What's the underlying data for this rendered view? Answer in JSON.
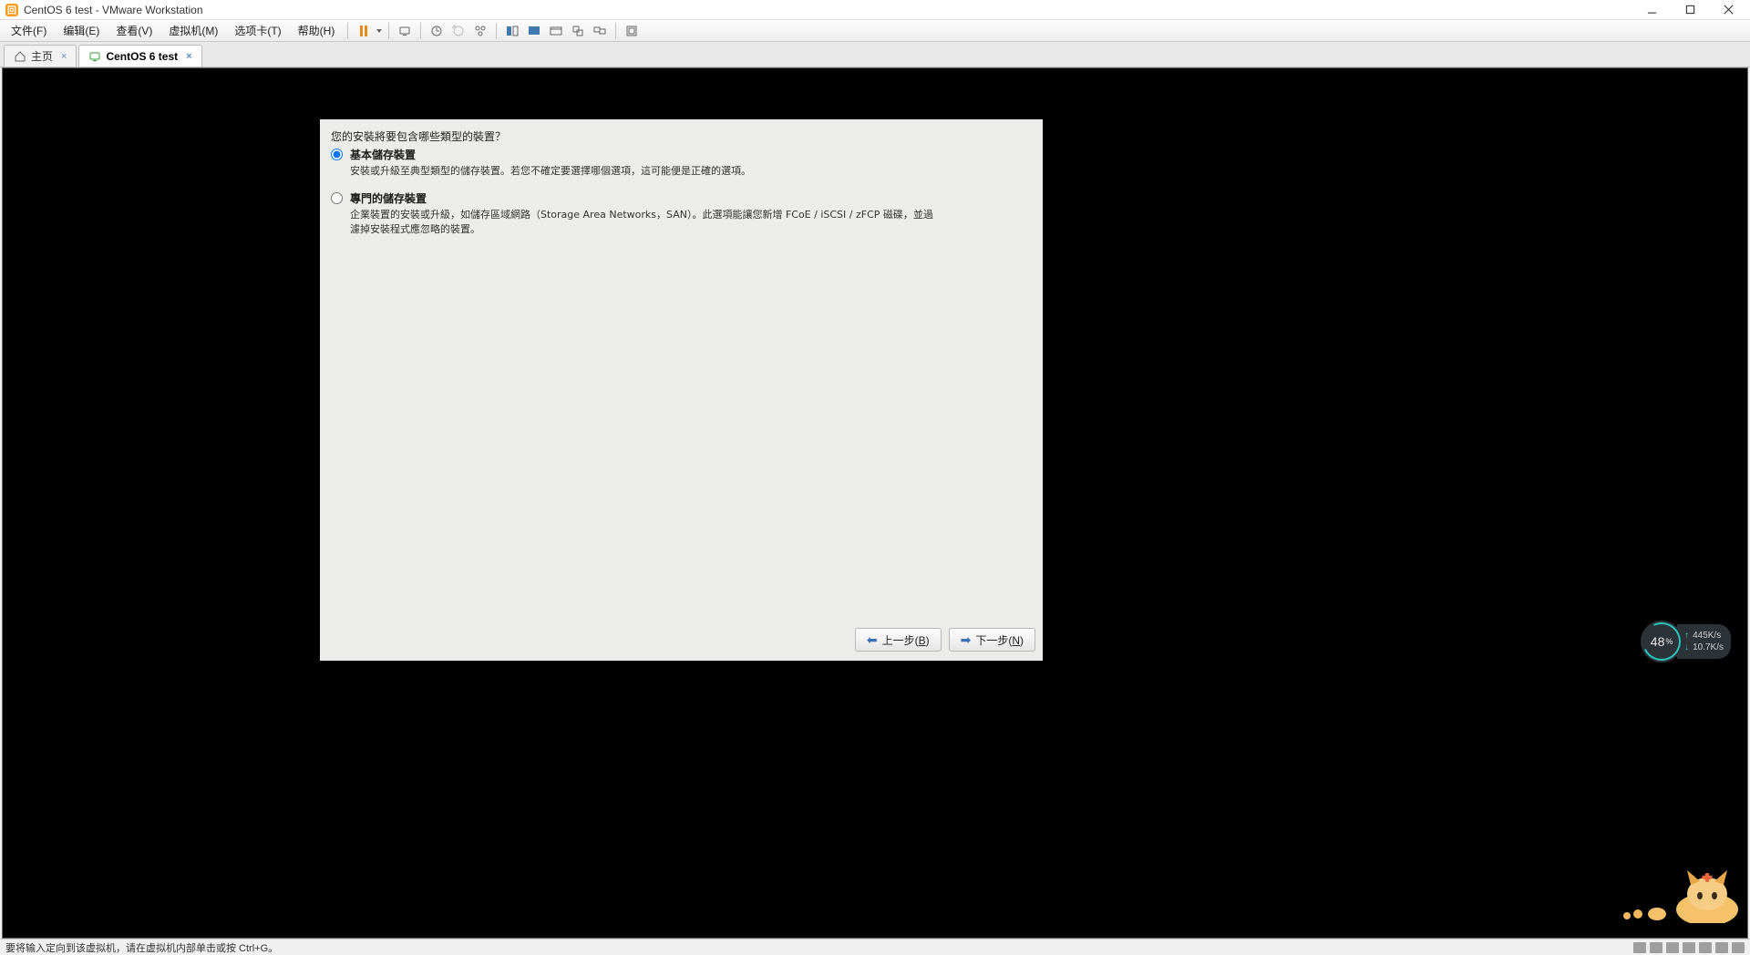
{
  "title": "CentOS 6 test - VMware Workstation",
  "menus": {
    "file": "文件(F)",
    "edit": "编辑(E)",
    "view": "查看(V)",
    "vm": "虚拟机(M)",
    "tabs": "选项卡(T)",
    "help": "帮助(H)"
  },
  "tabs": {
    "home": "主页",
    "vm_tab": "CentOS 6 test"
  },
  "installer": {
    "question": "您的安裝將要包含哪些類型的裝置？",
    "option1_title": "基本儲存裝置",
    "option1_desc": "安裝或升級至典型類型的儲存裝置。若您不確定要選擇哪個選項，這可能便是正確的選項。",
    "option2_title": "專門的儲存裝置",
    "option2_desc": "企業裝置的安裝或升級，如儲存區域網路（Storage Area Networks，SAN）。此選項能讓您新增 FCoE / iSCSI / zFCP 磁碟，並過濾掉安裝程式應忽略的裝置。",
    "back_btn": "上一步(B)",
    "next_btn": "下一步(N)"
  },
  "statusbar": {
    "hint": "要将输入定向到该虚拟机，请在虚拟机内部单击或按 Ctrl+G。"
  },
  "perf": {
    "percent": "48",
    "percent_suffix": "%",
    "up_speed": "445K/s",
    "down_speed": "10.7K/s"
  }
}
